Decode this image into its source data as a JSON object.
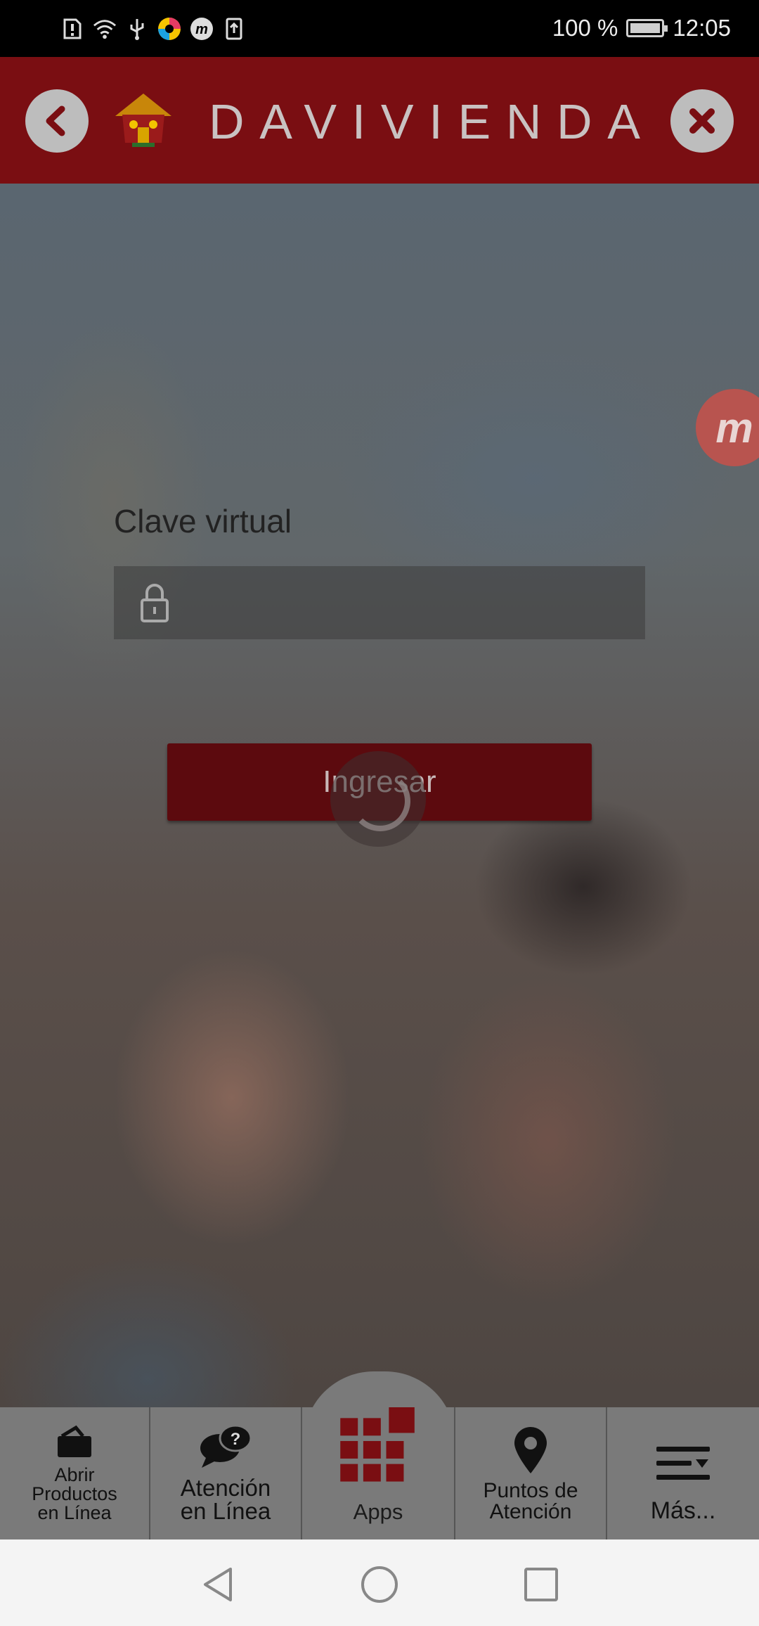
{
  "status_bar": {
    "battery_text": "100 %",
    "time": "12:05",
    "icons": [
      "alert-icon",
      "wifi-icon",
      "usb-icon",
      "color-app-icon",
      "m-app-icon",
      "upload-icon"
    ]
  },
  "header": {
    "brand": "DAVIVIENDA",
    "back_icon": "chevron-left-icon",
    "close_icon": "close-icon",
    "colors": {
      "header_bg": "#7a0e12",
      "button_bg": "#bdbdbd"
    }
  },
  "floating_button": {
    "label": "m"
  },
  "login": {
    "password_label": "Clave virtual",
    "password_placeholder": "",
    "submit_label": "Ingresar"
  },
  "bottom_nav": {
    "items": [
      {
        "label_line1": "Abrir",
        "label_line2": "Productos",
        "label_line3": "en Línea",
        "icon": "wallet-icon"
      },
      {
        "label_line1": "Atención",
        "label_line2": "en Línea",
        "icon": "chat-help-icon"
      },
      {
        "label_line1": "Apps",
        "icon": "apps-grid-icon"
      },
      {
        "label_line1": "Puntos de",
        "label_line2": "Atención",
        "icon": "location-pin-icon"
      },
      {
        "label_line1": "Más...",
        "icon": "menu-icon"
      }
    ]
  },
  "system_nav": {
    "icons": [
      "back-triangle-icon",
      "home-circle-icon",
      "recents-square-icon"
    ]
  }
}
